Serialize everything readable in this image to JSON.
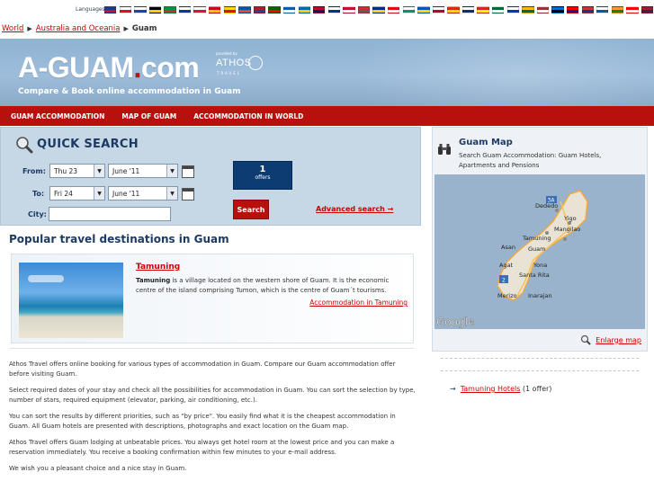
{
  "langbar": {
    "label": "Languages:",
    "flags": [
      {
        "name": "uk-flag",
        "c1": "#1a3b8a",
        "c2": "#c8102e"
      },
      {
        "name": "cz-flag",
        "c1": "#ffffff",
        "c2": "#d7141a"
      },
      {
        "name": "sk-flag",
        "c1": "#ffffff",
        "c2": "#0b4ea2"
      },
      {
        "name": "de-flag",
        "c1": "#000000",
        "c2": "#ffce00"
      },
      {
        "name": "it-flag",
        "c1": "#009246",
        "c2": "#ce2b37"
      },
      {
        "name": "ru-flag",
        "c1": "#ffffff",
        "c2": "#0039a6"
      },
      {
        "name": "pl-flag",
        "c1": "#ffffff",
        "c2": "#dc143c"
      },
      {
        "name": "es-flag",
        "c1": "#c60b1e",
        "c2": "#ffc400"
      },
      {
        "name": "ca-flag",
        "c1": "#fcdd09",
        "c2": "#da121a"
      },
      {
        "name": "fr-flag",
        "c1": "#0055a4",
        "c2": "#ef4135"
      },
      {
        "name": "nl-flag",
        "c1": "#ae1c28",
        "c2": "#21468b"
      },
      {
        "name": "pt-flag",
        "c1": "#006600",
        "c2": "#ff0000"
      },
      {
        "name": "gr-flag",
        "c1": "#0d5eaf",
        "c2": "#ffffff"
      },
      {
        "name": "se-flag",
        "c1": "#006aa7",
        "c2": "#fecc00"
      },
      {
        "name": "no-flag",
        "c1": "#ba0c2f",
        "c2": "#00205b"
      },
      {
        "name": "fi-flag",
        "c1": "#ffffff",
        "c2": "#003580"
      },
      {
        "name": "dk-flag",
        "c1": "#c8102e",
        "c2": "#ffffff"
      },
      {
        "name": "hu-flag",
        "c1": "#cd2a3e",
        "c2": "#436f4d"
      },
      {
        "name": "ro-flag",
        "c1": "#002b7f",
        "c2": "#fcd116"
      },
      {
        "name": "tr-flag",
        "c1": "#e30a17",
        "c2": "#ffffff"
      },
      {
        "name": "bg-flag",
        "c1": "#ffffff",
        "c2": "#00966e"
      },
      {
        "name": "ua-flag",
        "c1": "#0057b7",
        "c2": "#ffd700"
      },
      {
        "name": "jp-flag",
        "c1": "#ffffff",
        "c2": "#bc002d"
      },
      {
        "name": "cn-flag",
        "c1": "#de2910",
        "c2": "#ffde00"
      },
      {
        "name": "kr-flag",
        "c1": "#ffffff",
        "c2": "#003478"
      },
      {
        "name": "vn-flag",
        "c1": "#da251d",
        "c2": "#ffff00"
      },
      {
        "name": "sa-flag",
        "c1": "#006c35",
        "c2": "#ffffff"
      },
      {
        "name": "il-flag",
        "c1": "#ffffff",
        "c2": "#0038b8"
      },
      {
        "name": "lt-flag",
        "c1": "#fdb913",
        "c2": "#006a44"
      },
      {
        "name": "lv-flag",
        "c1": "#9e3039",
        "c2": "#ffffff"
      },
      {
        "name": "ee-flag",
        "c1": "#0072ce",
        "c2": "#000000"
      },
      {
        "name": "hr-flag",
        "c1": "#ff0000",
        "c2": "#171796"
      },
      {
        "name": "rs-flag",
        "c1": "#c6363c",
        "c2": "#0c4076"
      },
      {
        "name": "si-flag",
        "c1": "#ffffff",
        "c2": "#005da4"
      },
      {
        "name": "in-flag",
        "c1": "#ff9933",
        "c2": "#138808"
      },
      {
        "name": "id-flag",
        "c1": "#ff0000",
        "c2": "#ffffff"
      },
      {
        "name": "th-flag",
        "c1": "#a51931",
        "c2": "#2d2a4a"
      },
      {
        "name": "my-flag",
        "c1": "#cc0001",
        "c2": "#010066"
      }
    ]
  },
  "breadcrumb": {
    "world": "World",
    "region": "Australia and Oceania",
    "current": "Guam"
  },
  "header": {
    "logo_main": "A-GUAM",
    "logo_dot": ".",
    "logo_tld": "com",
    "athos_by": "provided by",
    "athos_name": "ATHOS",
    "athos_travel": "TRAVEL",
    "tagline": "Compare & Book online accommodation in Guam"
  },
  "nav": {
    "items": [
      "GUAM ACCOMMODATION",
      "MAP OF GUAM",
      "ACCOMMODATION IN WORLD"
    ]
  },
  "quick_search": {
    "title": "QUICK SEARCH",
    "from_label": "From:",
    "to_label": "To:",
    "city_label": "City:",
    "from_day": "Thu 23",
    "from_month": "June '11",
    "to_day": "Fri 24",
    "to_month": "June '11",
    "city_value": "",
    "offers_count": "1",
    "offers_label": "offers",
    "search_label": "Search",
    "advanced_label": "Advanced search →"
  },
  "popular": {
    "heading": "Popular travel destinations in Guam",
    "dest_name": "Tamuning",
    "dest_bold": "Tamuning",
    "dest_text": " is a village located on the western shore of Guam. It is the economic centre of the island comprising Tumon, which is the centre of Guam´t tourisms.",
    "dest_link": "Accommodation in Tamuning"
  },
  "body": {
    "p1": "Athos Travel offers online booking for various types of accommodation in Guam. Compare our Guam accommodation offer before visiting Guam.",
    "p2": "Select required dates of your stay and check all the possibilities for accommodation in Guam. You can sort the selection by type, number of stars, required equipment (elevator, parking, air conditioning, etc.).",
    "p3": "You can sort the results by different priorities, such as \"by price\". You easily find what it is the cheapest accommodation in Guam. All Guam hotels are presented with descriptions, photographs and exact location on the Guam map.",
    "p4": "Athos Travel offers Guam lodging at unbeatable prices. You always get hotel room at the lowest price and you can make a reservation immediately. You receive a booking confirmation within few minutes to your e-mail address.",
    "p5": "We wish you a pleasant choice and a nice stay in Guam."
  },
  "map": {
    "title": "Guam Map",
    "subtitle": "Search Guam Accommodation: Guam Hotels, Apartments and Pensions",
    "places": [
      "Dededo",
      "Yigo",
      "Tamuning",
      "Mangilao",
      "Asan",
      "Guam",
      "Agat",
      "Yona",
      "Santa Rita",
      "Merizo",
      "Inarajan"
    ],
    "shield_3a": "3A",
    "shield_2": "2",
    "google": "Google",
    "enlarge": "Enlarge map"
  },
  "right_links": {
    "link_text": "Tamuning Hotels",
    "suffix": " (1 offer)",
    "arrow": "→"
  }
}
